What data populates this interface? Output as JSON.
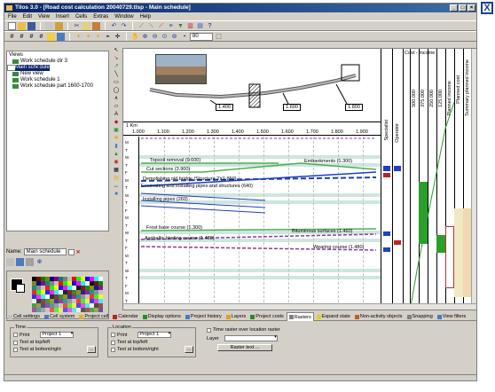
{
  "window": {
    "title": "Tilos 3.0 - [Road cost calculation 20040729.tlsp - Main schedule]",
    "close_glyph": "X"
  },
  "menu": [
    "File",
    "Edit",
    "View",
    "Insert",
    "Cells",
    "Extras",
    "Window",
    "Help"
  ],
  "toolbar": {
    "zoom_value": "80"
  },
  "views": {
    "title": "Views",
    "items": [
      {
        "label": "Work schedule dir 3"
      },
      {
        "label": "Main schedule",
        "selected": true
      },
      {
        "label": "New view"
      },
      {
        "label": "Work schedule 1"
      },
      {
        "label": "Work schedule part 1600-1700"
      }
    ]
  },
  "name": {
    "label": "Name:",
    "value": "Main schedule"
  },
  "map": {
    "boxes": [
      "1.400",
      "1.600",
      "1.800"
    ]
  },
  "ruler": {
    "unit": "1 Km",
    "ticks": [
      "1.000",
      "1.100",
      "1.200",
      "1.300",
      "1.400",
      "1.500",
      "1.600",
      "1.700",
      "1.800",
      "1.900"
    ]
  },
  "time_labels": [
    "M",
    "T",
    "W",
    "T",
    "F",
    "M",
    "T",
    "W",
    "T",
    "F",
    "M",
    "T",
    "W",
    "T",
    "F",
    "M",
    "T",
    "W",
    "T",
    "F",
    "M",
    "T"
  ],
  "activities": [
    {
      "label": "Topsoil removal (9.600)"
    },
    {
      "label": "Cut sections (3.900)"
    },
    {
      "label": "Embankments (1.300)"
    },
    {
      "label": "Demolishing old bridge (Structure 2)(1.850)"
    },
    {
      "label": "Excavating and installing pipes and structures (640)"
    },
    {
      "label": "Installing pipes (260)"
    },
    {
      "label": "Frost base course (1.300)"
    },
    {
      "label": "Asphaltic binding course (1.480)"
    },
    {
      "label": "Bituminous surfaces (1.460)"
    },
    {
      "label": "Wearing course (1.480)"
    }
  ],
  "right_columns": {
    "specialist": "Specialist",
    "operator": "Operator",
    "costs_title": "Cost - Income",
    "headers": [
      "500.000",
      "375.000",
      "250.000",
      "125.000",
      "Planned income",
      "Planned cost",
      "Summary planned income",
      "Summary planned cost"
    ]
  },
  "tabs": [
    "Cell settings",
    "Cell system",
    "Project cell",
    "Calendar",
    "Display options",
    "Project history",
    "Layers",
    "Project costs",
    "Rasters",
    "Expand state",
    "Non-activity objects",
    "Snapping",
    "View filters"
  ],
  "bottom": {
    "time": {
      "legend": "Time",
      "print_label": "Print",
      "project_value": "Project 1",
      "top_left": "Text at top/left",
      "bottom_right": "Text at bottom/right"
    },
    "location": {
      "legend": "Location",
      "print_label": "Print",
      "project_value": "Project 1",
      "top_left": "Text at top/left",
      "bottom_right": "Text at bottom/right"
    },
    "raster_check": "Time raster over location raster",
    "layer_label": "Layer",
    "raster_button": "Raster text ..."
  },
  "colors": {
    "title_gradient": "#0a246a",
    "green_line": "#4caf50",
    "blue_line": "#1f3fbf",
    "purple_dash": "#8a3aa8",
    "band": "#cfe6df"
  }
}
